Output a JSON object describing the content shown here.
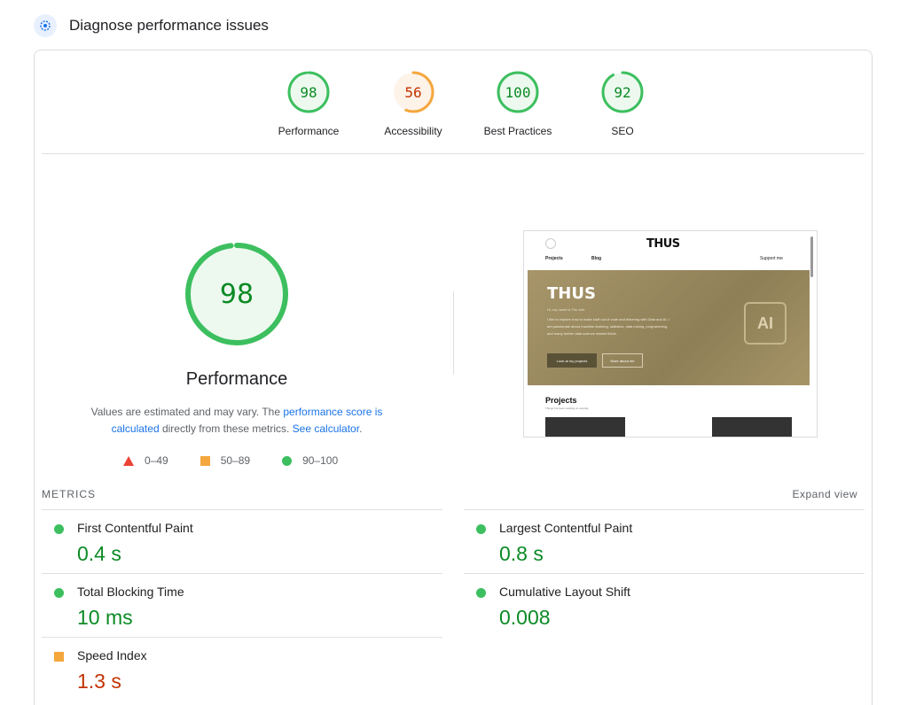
{
  "header": {
    "title": "Diagnose performance issues",
    "icon": "speedometer-icon"
  },
  "colors": {
    "pass": "#0c8a25",
    "average": "#c33300",
    "pass_stroke": "#3dbf5f",
    "average_stroke": "#f4a73d",
    "fail": "#eb4335",
    "link": "#1a73e8"
  },
  "categories": [
    {
      "label": "Performance",
      "score": 98,
      "status": "pass"
    },
    {
      "label": "Accessibility",
      "score": 56,
      "status": "average"
    },
    {
      "label": "Best Practices",
      "score": 100,
      "status": "pass"
    },
    {
      "label": "SEO",
      "score": 92,
      "status": "pass"
    }
  ],
  "main": {
    "score": 98,
    "title": "Performance",
    "note_pre": "Values are estimated and may vary. The ",
    "note_link1": "performance score is calculated",
    "note_mid": " directly from these metrics. ",
    "note_link2": "See calculator",
    "note_post": "."
  },
  "legend": [
    {
      "label": "0–49",
      "shape": "triangle"
    },
    {
      "label": "50–89",
      "shape": "square"
    },
    {
      "label": "90–100",
      "shape": "circle"
    }
  ],
  "screenshot": {
    "logo": "THUS",
    "nav": [
      "Projects",
      "Blog",
      "Support me"
    ],
    "hero_title": "THUS",
    "hero_sub": "Hi, my name is Thu Anh",
    "hero_text": "I like to explore how to make stuff out of code and tinkering with Data and AI. I am passionate about machine learning, statistics, data mining, programming, and many further data science related fields.",
    "btn1": "Look at my projects",
    "btn2": "More about me",
    "chip": "AI",
    "projects_title": "Projects",
    "projects_sub": "Things I've been working on recently"
  },
  "metrics": {
    "title": "METRICS",
    "expand_label": "Expand view",
    "items": [
      {
        "name": "First Contentful Paint",
        "value": "0.4 s",
        "status": "pass"
      },
      {
        "name": "Largest Contentful Paint",
        "value": "0.8 s",
        "status": "pass"
      },
      {
        "name": "Total Blocking Time",
        "value": "10 ms",
        "status": "pass"
      },
      {
        "name": "Cumulative Layout Shift",
        "value": "0.008",
        "status": "pass"
      },
      {
        "name": "Speed Index",
        "value": "1.3 s",
        "status": "average"
      }
    ]
  }
}
